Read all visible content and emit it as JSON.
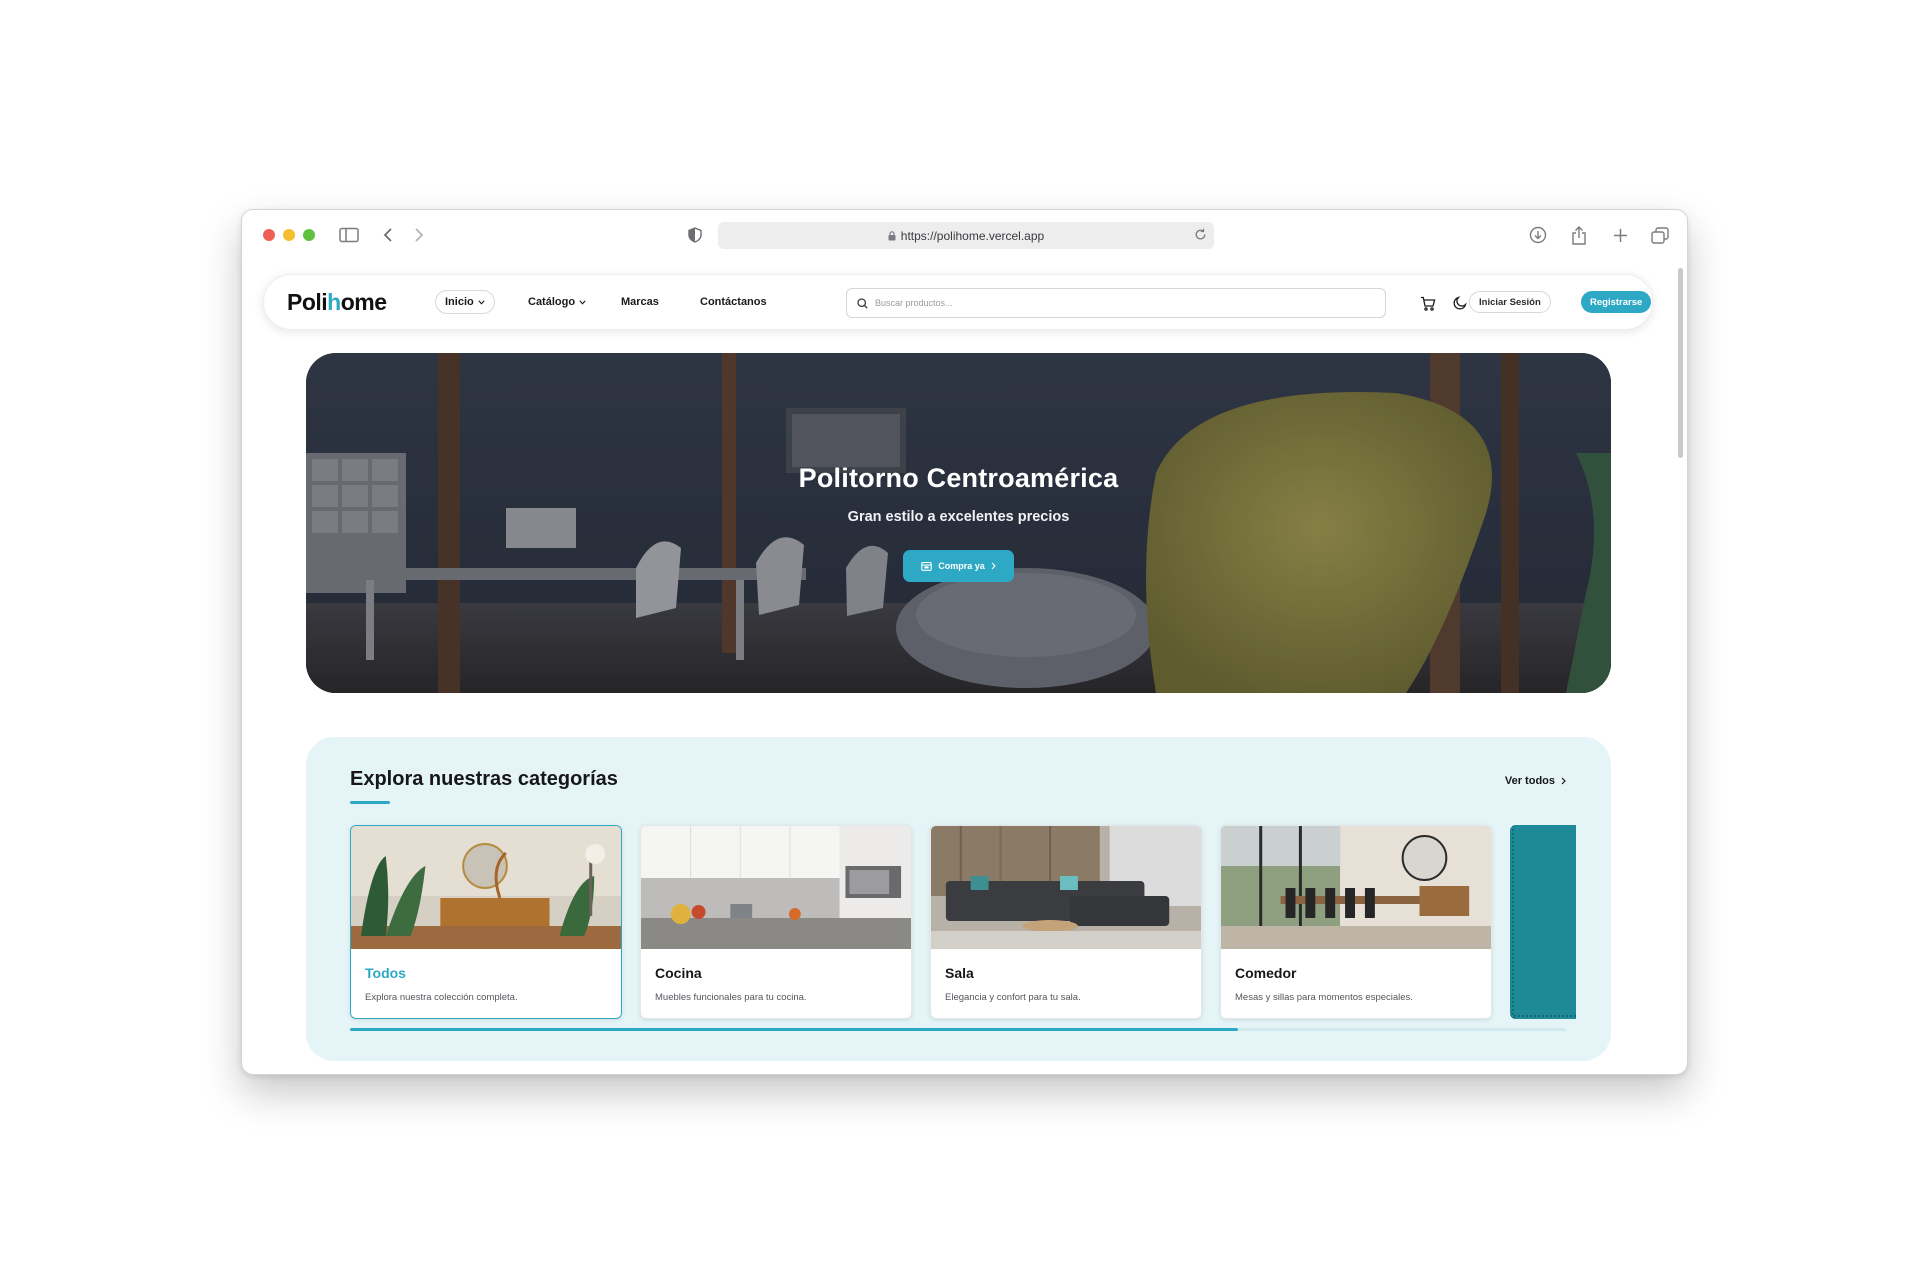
{
  "browser": {
    "url": "https://polihome.vercel.app"
  },
  "navbar": {
    "logo_prefix": "Poli",
    "logo_accent": "h",
    "logo_suffix": "ome",
    "items": [
      {
        "label": "Inicio"
      },
      {
        "label": "Catálogo"
      },
      {
        "label": "Marcas"
      },
      {
        "label": "Contáctanos"
      }
    ],
    "search_placeholder": "Buscar productos...",
    "login_label": "Iniciar Sesión",
    "register_label": "Registrarse"
  },
  "hero": {
    "title": "Politorno Centroamérica",
    "subtitle": "Gran estilo a excelentes precios",
    "cta_label": "Compra ya"
  },
  "categories": {
    "title": "Explora nuestras categorías",
    "see_all_label": "Ver todos",
    "cards": [
      {
        "name": "Todos",
        "description": "Explora nuestra colección completa."
      },
      {
        "name": "Cocina",
        "description": "Muebles funcionales para tu cocina."
      },
      {
        "name": "Sala",
        "description": "Elegancia y confort para tu sala."
      },
      {
        "name": "Comedor",
        "description": "Mesas y sillas para momentos especiales."
      }
    ],
    "scroll_progress": 0.73
  },
  "colors": {
    "accent": "#2ea9c5",
    "section_bg": "#e4f4f7"
  },
  "icons": [
    "sidebar-icon",
    "back-icon",
    "forward-icon",
    "shield-icon",
    "lock-icon",
    "reload-icon",
    "download-icon",
    "share-icon",
    "new-tab-icon",
    "tabs-overview-icon",
    "search-icon",
    "cart-icon",
    "moon-icon",
    "calendar-icon",
    "chevron-down-icon",
    "chevron-right-icon"
  ]
}
